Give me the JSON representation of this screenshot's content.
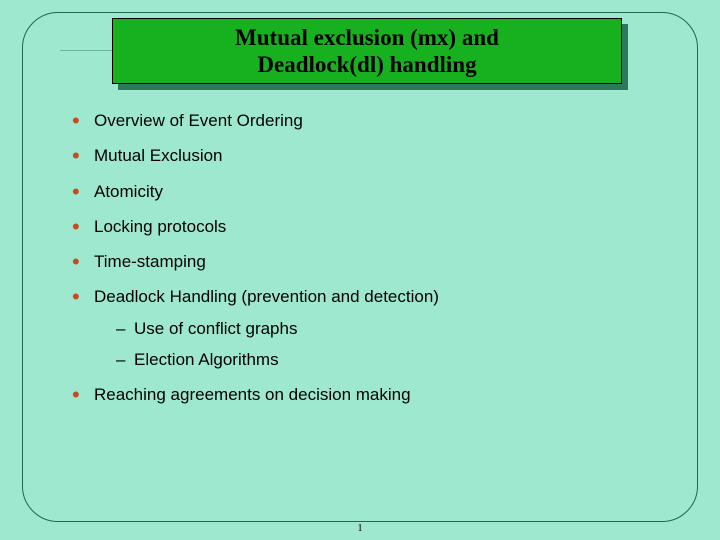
{
  "title": {
    "line1": "Mutual exclusion (mx) and",
    "line2": "Deadlock(dl) handling"
  },
  "bullets": [
    {
      "text": "Overview of Event Ordering"
    },
    {
      "text": "Mutual Exclusion"
    },
    {
      "text": "Atomicity"
    },
    {
      "text": "Locking protocols"
    },
    {
      "text": "Time-stamping"
    },
    {
      "text": "Deadlock Handling (prevention and detection)",
      "sub": [
        "Use of conflict graphs",
        "Election Algorithms"
      ]
    },
    {
      "text": "Reaching agreements on decision making"
    }
  ],
  "page_number": "1"
}
